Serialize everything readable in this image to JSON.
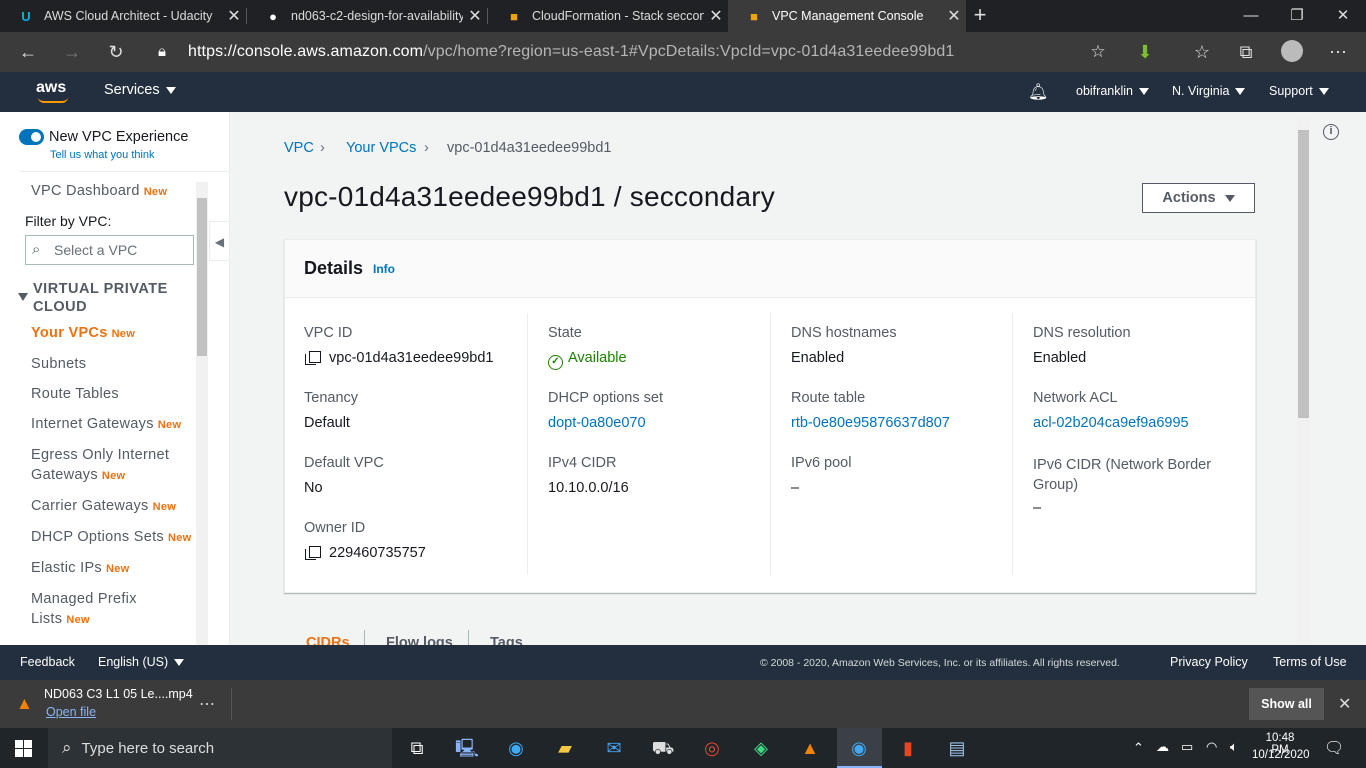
{
  "browser": {
    "tabs": [
      {
        "title": "AWS Cloud Architect - Udacity",
        "icon": "udacity-icon"
      },
      {
        "title": "nd063-c2-design-for-availability",
        "icon": "github-icon"
      },
      {
        "title": "CloudFormation - Stack seccondary",
        "icon": "aws-box-icon"
      },
      {
        "title": "VPC Management Console",
        "icon": "aws-box-icon",
        "active": true
      }
    ],
    "url_host": "https://console.aws.amazon.com",
    "url_path": "/vpc/home?region=us-east-1#VpcDetails:VpcId=vpc-01d4a31eedee99bd1"
  },
  "aws_header": {
    "logo": "aws",
    "services": "Services",
    "user": "obifranklin",
    "region": "N. Virginia",
    "support": "Support"
  },
  "sidebar": {
    "new_experience": "New VPC Experience",
    "feedback_link": "Tell us what you think",
    "dashboard": "VPC Dashboard",
    "new_badge": "New",
    "filter_label": "Filter by VPC:",
    "filter_placeholder": "Select a VPC",
    "group": "VIRTUAL PRIVATE CLOUD",
    "items": [
      {
        "label": "Your VPCs",
        "new": "New"
      },
      {
        "label": "Subnets"
      },
      {
        "label": "Route Tables"
      },
      {
        "label": "Internet Gateways",
        "new": "New"
      },
      {
        "label": "Egress Only Internet Gateways",
        "new": "New"
      },
      {
        "label": "Carrier Gateways",
        "new": "New"
      },
      {
        "label": "DHCP Options Sets",
        "new": "New"
      },
      {
        "label": "Elastic IPs",
        "new": "New"
      },
      {
        "label": "Managed Prefix Lists",
        "new": "New"
      }
    ]
  },
  "breadcrumb": [
    "VPC",
    "Your VPCs",
    "vpc-01d4a31eedee99bd1"
  ],
  "page_title": "vpc-01d4a31eedee99bd1 / seccondary",
  "actions_label": "Actions",
  "details": {
    "title": "Details",
    "info": "Info",
    "vpc_id_label": "VPC ID",
    "vpc_id": "vpc-01d4a31eedee99bd1",
    "tenancy_label": "Tenancy",
    "tenancy": "Default",
    "default_vpc_label": "Default VPC",
    "default_vpc": "No",
    "owner_label": "Owner ID",
    "owner": "229460735757",
    "state_label": "State",
    "state": "Available",
    "dhcp_label": "DHCP options set",
    "dhcp": "dopt-0a80e070",
    "ipv4_label": "IPv4 CIDR",
    "ipv4": "10.10.0.0/16",
    "dns_host_label": "DNS hostnames",
    "dns_host": "Enabled",
    "route_label": "Route table",
    "route": "rtb-0e80e95876637d807",
    "ipv6pool_label": "IPv6 pool",
    "ipv6pool": "–",
    "dns_res_label": "DNS resolution",
    "dns_res": "Enabled",
    "acl_label": "Network ACL",
    "acl": "acl-02b204ca9ef9a6995",
    "ipv6cidr_label": "IPv6 CIDR (Network Border Group)",
    "ipv6cidr": "–"
  },
  "bottom_tabs": [
    "CIDRs",
    "Flow logs",
    "Tags"
  ],
  "footer": {
    "feedback": "Feedback",
    "language": "English (US)",
    "copyright": "© 2008 - 2020, Amazon Web Services, Inc. or its affiliates. All rights reserved.",
    "privacy": "Privacy Policy",
    "terms": "Terms of Use"
  },
  "download": {
    "file": "ND063 C3 L1 05 Le....mp4",
    "open": "Open file",
    "show_all": "Show all"
  },
  "taskbar": {
    "search": "Type here to search",
    "time": "10:48 PM",
    "date": "10/12/2020"
  },
  "colors": {
    "aws_nav": "#232f3e",
    "link": "#0073bb",
    "orange": "#ec7211",
    "success": "#1d8102"
  }
}
